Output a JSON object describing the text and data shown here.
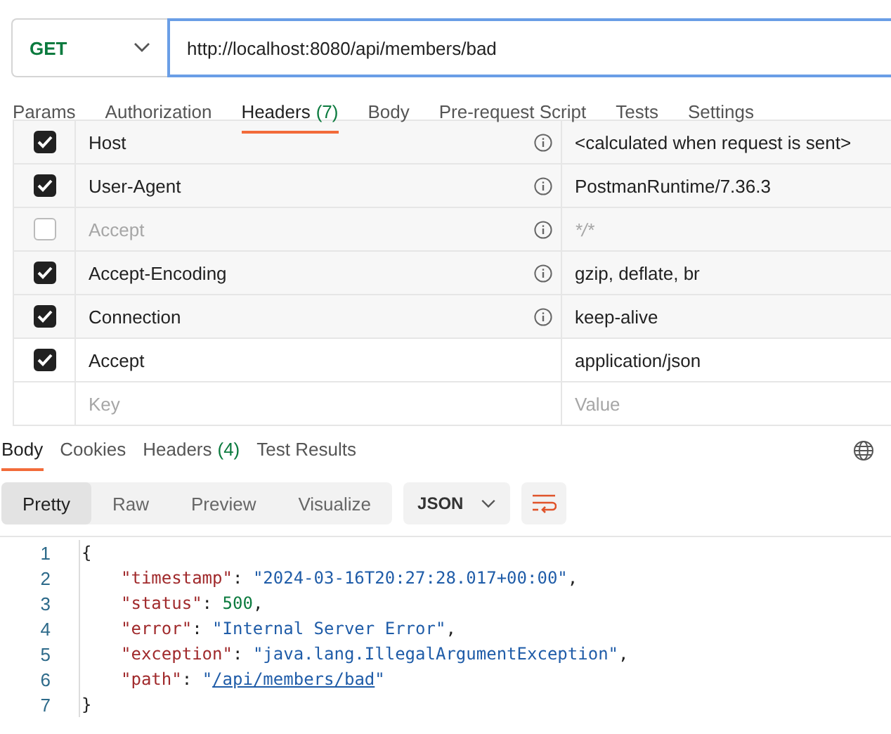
{
  "request": {
    "method": "GET",
    "url": "http://localhost:8080/api/members/bad"
  },
  "request_tabs": [
    {
      "label": "Params",
      "selected": false
    },
    {
      "label": "Authorization",
      "selected": false
    },
    {
      "label": "Headers",
      "count": "(7)",
      "selected": true
    },
    {
      "label": "Body",
      "selected": false
    },
    {
      "label": "Pre-request Script",
      "selected": false
    },
    {
      "label": "Tests",
      "selected": false
    },
    {
      "label": "Settings",
      "selected": false
    }
  ],
  "headers": [
    {
      "key": "Host",
      "value": "<calculated when request is sent>",
      "checked": true,
      "info": true
    },
    {
      "key": "User-Agent",
      "value": "PostmanRuntime/7.36.3",
      "checked": true,
      "info": true
    },
    {
      "key": "Accept",
      "value": "*/*",
      "checked": false,
      "info": true
    },
    {
      "key": "Accept-Encoding",
      "value": "gzip, deflate, br",
      "checked": true,
      "info": true
    },
    {
      "key": "Connection",
      "value": "keep-alive",
      "checked": true,
      "info": true
    },
    {
      "key": "Accept",
      "value": "application/json",
      "checked": true,
      "info": false
    }
  ],
  "new_header": {
    "key_placeholder": "Key",
    "value_placeholder": "Value"
  },
  "response_tabs": [
    {
      "label": "Body",
      "selected": true
    },
    {
      "label": "Cookies",
      "selected": false
    },
    {
      "label": "Headers",
      "count": "(4)",
      "selected": false
    },
    {
      "label": "Test Results",
      "selected": false
    }
  ],
  "view_modes": [
    {
      "label": "Pretty",
      "selected": true
    },
    {
      "label": "Raw",
      "selected": false
    },
    {
      "label": "Preview",
      "selected": false
    },
    {
      "label": "Visualize",
      "selected": false
    }
  ],
  "format": "JSON",
  "code_lines": [
    {
      "number": "1",
      "kind": "brace",
      "tokens": [
        {
          "kind": "punct",
          "text": "{"
        }
      ]
    },
    {
      "number": "2",
      "kind": "entry",
      "tokens": [
        {
          "kind": "key",
          "text": "\"timestamp\""
        },
        {
          "kind": "punct",
          "text": ": "
        },
        {
          "kind": "string",
          "text": "\"2024-03-16T20:27:28.017+00:00\""
        },
        {
          "kind": "punct",
          "text": ","
        }
      ]
    },
    {
      "number": "3",
      "kind": "entry",
      "tokens": [
        {
          "kind": "key",
          "text": "\"status\""
        },
        {
          "kind": "punct",
          "text": ": "
        },
        {
          "kind": "number",
          "text": "500"
        },
        {
          "kind": "punct",
          "text": ","
        }
      ]
    },
    {
      "number": "4",
      "kind": "entry",
      "tokens": [
        {
          "kind": "key",
          "text": "\"error\""
        },
        {
          "kind": "punct",
          "text": ": "
        },
        {
          "kind": "string",
          "text": "\"Internal Server Error\""
        },
        {
          "kind": "punct",
          "text": ","
        }
      ]
    },
    {
      "number": "5",
      "kind": "entry",
      "tokens": [
        {
          "kind": "key",
          "text": "\"exception\""
        },
        {
          "kind": "punct",
          "text": ": "
        },
        {
          "kind": "string",
          "text": "\"java.lang.IllegalArgumentException\""
        },
        {
          "kind": "punct",
          "text": ","
        }
      ]
    },
    {
      "number": "6",
      "kind": "entry",
      "tokens": [
        {
          "kind": "key",
          "text": "\"path\""
        },
        {
          "kind": "punct",
          "text": ": "
        },
        {
          "kind": "string",
          "text": "\""
        },
        {
          "kind": "link",
          "text": "/api/members/bad"
        },
        {
          "kind": "string",
          "text": "\""
        }
      ]
    },
    {
      "number": "7",
      "kind": "brace",
      "tokens": [
        {
          "kind": "punct",
          "text": "}"
        }
      ]
    }
  ]
}
